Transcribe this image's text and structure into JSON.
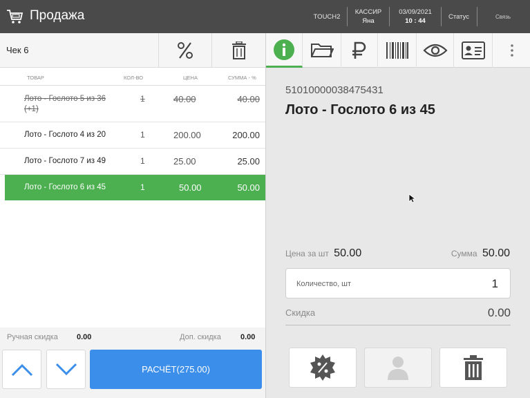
{
  "header": {
    "title": "Продажа",
    "terminal": "TOUCH2",
    "cashier_label": "КАССИР",
    "cashier_name": "Яна",
    "date": "03/09/2021",
    "time": "10 : 44",
    "status": "Статус",
    "connection": "Связь"
  },
  "check": {
    "title": "Чек 6",
    "discount_icon": "percent-icon",
    "delete_icon": "trash-icon",
    "columns": [
      "ТОВАР",
      "КОЛ-ВО",
      "ЦЕНА",
      "СУММА - %"
    ],
    "rows": [
      {
        "name": "Лото - Гослото 5 из 36",
        "name2": "(+1)",
        "qty": "1",
        "price": "40.00",
        "sum": "40.00",
        "struck": true
      },
      {
        "name": "Лото - Гослото 4 из 20",
        "qty": "1",
        "price": "200.00",
        "sum": "200.00"
      },
      {
        "name": "Лото - Гослото 7 из 49",
        "qty": "1",
        "price": "25.00",
        "sum": "25.00"
      },
      {
        "name": "Лото - Гослото 6 из 45",
        "qty": "1",
        "price": "50.00",
        "sum": "50.00",
        "selected": true
      }
    ],
    "manual_discount_label": "Ручная скидка",
    "manual_discount_value": "0.00",
    "extra_discount_label": "Доп. скидка",
    "extra_discount_value": "0.00",
    "pay_button": "РАСЧЁТ(275.00)"
  },
  "detail": {
    "tabs": [
      "info-icon",
      "folder-icon",
      "ruble-icon",
      "barcode-icon",
      "eye-icon",
      "id-card-icon",
      "more-icon"
    ],
    "barcode": "51010000038475431",
    "item_title": "Лото - Гослото 6 из 45",
    "unit_price_label": "Цена за шт",
    "unit_price": "50.00",
    "sum_label": "Сумма",
    "sum": "50.00",
    "qty_placeholder": "Количество, шт",
    "qty_value": "1",
    "discount_label": "Скидка",
    "discount_value": "0.00",
    "actions": [
      "discount-badge-icon",
      "customer-icon",
      "trash-icon"
    ]
  },
  "colors": {
    "accent": "#4caf50",
    "primary": "#3b8eea",
    "topbar": "#4a4a4a"
  }
}
